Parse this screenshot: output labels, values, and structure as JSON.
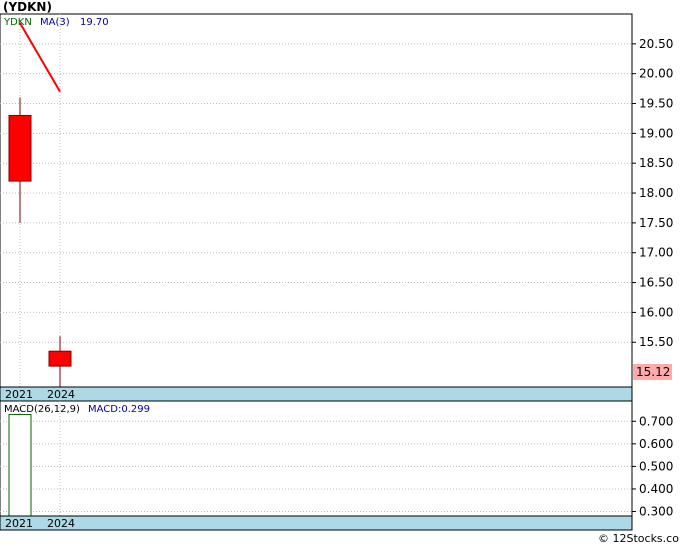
{
  "title": "(YDKN)",
  "watermark": "© 12Stocks.com",
  "colors": {
    "up": "#ff0000",
    "down": "#ff0000",
    "ma": "#ff0000",
    "grid": "#bbbbbb",
    "band": "#add8e6",
    "lastPriceBg": "#ffaaaa",
    "macdBar": "#ffffff",
    "macdBarStroke": "#006400",
    "tickerColor": "#006400",
    "maLabelColor": "#0000aa"
  },
  "chart_data": [
    {
      "type": "candlestick",
      "ticker": "YDKN",
      "ma_label": "MA(3)",
      "ma_value_label": "19.70",
      "last_price_label": "15.12",
      "categories": [
        "2021",
        "2024"
      ],
      "ohlc": [
        {
          "x": "2021",
          "open": 18.2,
          "high": 19.6,
          "low": 17.5,
          "close": 19.3
        },
        {
          "x": "2024",
          "open": 15.1,
          "high": 15.6,
          "low": 14.75,
          "close": 15.35
        }
      ],
      "ma": [
        20.85,
        19.7
      ],
      "yticks": [
        15.5,
        16.0,
        16.5,
        17.0,
        17.5,
        18.0,
        18.5,
        19.0,
        19.5,
        20.0,
        20.5
      ],
      "ylim": [
        14.75,
        21.0
      ],
      "grid": true
    },
    {
      "type": "bar",
      "label": "MACD(26,12,9)",
      "value_label": "MACD:0.299",
      "categories": [
        "2021",
        "2024"
      ],
      "values": [
        0.73,
        0.299
      ],
      "yticks": [
        0.3,
        0.4,
        0.5,
        0.6,
        0.7
      ],
      "ylim": [
        0.28,
        0.79
      ],
      "grid": true
    }
  ],
  "axis_labels": {
    "price_ticks": [
      "15.50",
      "16.00",
      "16.50",
      "17.00",
      "17.50",
      "18.00",
      "18.50",
      "19.00",
      "19.50",
      "20.00",
      "20.50"
    ],
    "macd_ticks": [
      "0.300",
      "0.400",
      "0.500",
      "0.600",
      "0.700"
    ],
    "x": [
      "2021",
      "2024"
    ]
  }
}
